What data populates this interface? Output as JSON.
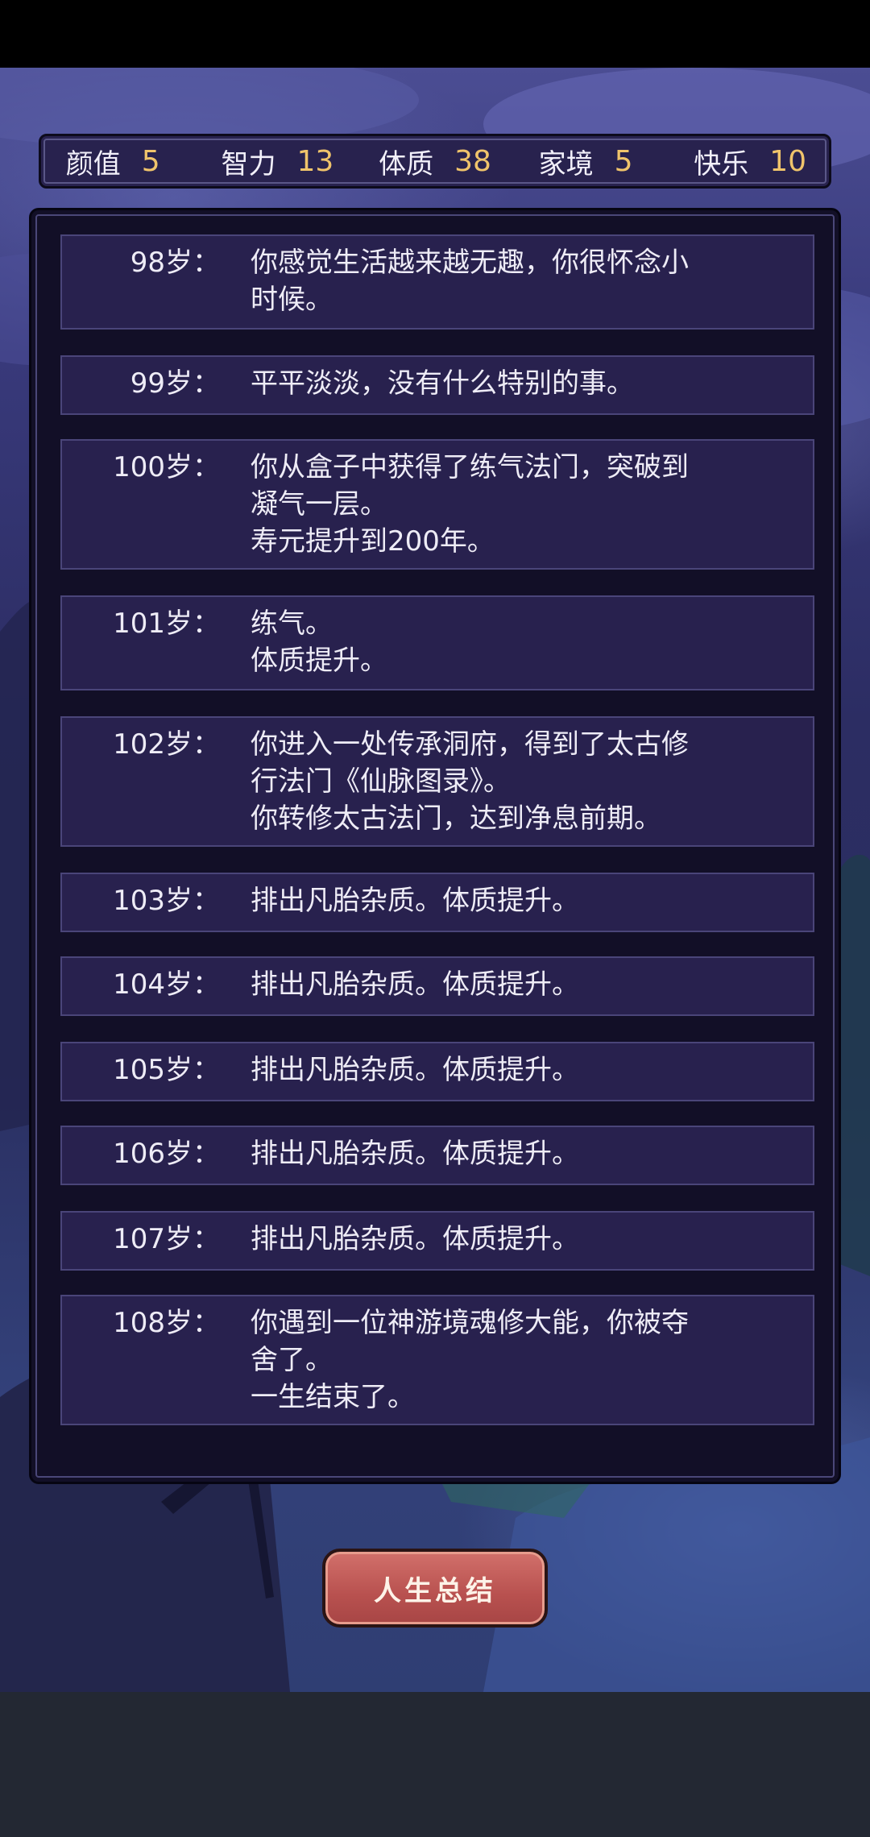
{
  "stats": [
    {
      "label": "颜值",
      "value": "5"
    },
    {
      "label": "智力",
      "value": "13"
    },
    {
      "label": "体质",
      "value": "38"
    },
    {
      "label": "家境",
      "value": "5"
    },
    {
      "label": "快乐",
      "value": "10"
    }
  ],
  "events": [
    {
      "age": "98岁：",
      "text": "你感觉生活越来越无趣，你很怀念小\n时候。"
    },
    {
      "age": "99岁：",
      "text": "平平淡淡，没有什么特别的事。"
    },
    {
      "age": "100岁：",
      "text": "你从盒子中获得了练气法门，突破到\n凝气一层。\n寿元提升到200年。"
    },
    {
      "age": "101岁：",
      "text": "练气。\n体质提升。"
    },
    {
      "age": "102岁：",
      "text": "你进入一处传承洞府，得到了太古修\n行法门《仙脉图录》。\n你转修太古法门，达到净息前期。"
    },
    {
      "age": "103岁：",
      "text": "排出凡胎杂质。体质提升。"
    },
    {
      "age": "104岁：",
      "text": "排出凡胎杂质。体质提升。"
    },
    {
      "age": "105岁：",
      "text": "排出凡胎杂质。体质提升。"
    },
    {
      "age": "106岁：",
      "text": "排出凡胎杂质。体质提升。"
    },
    {
      "age": "107岁：",
      "text": "排出凡胎杂质。体质提升。"
    },
    {
      "age": "108岁：",
      "text": "你遇到一位神游境魂修大能，你被夺\n舍了。\n一生结束了。"
    }
  ],
  "summary_button": {
    "label": "人生总结"
  },
  "colors": {
    "stat_value": "#f0c46b",
    "panel_bg": "#120f27",
    "row_bg": "#28214e",
    "button": "#b8514f"
  }
}
